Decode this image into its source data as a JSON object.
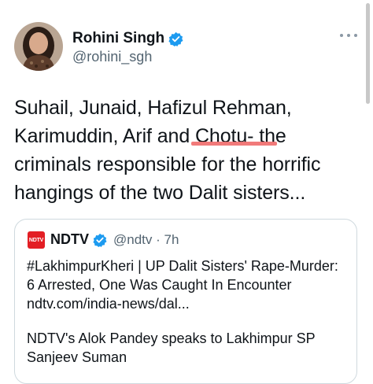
{
  "tweet": {
    "author": {
      "name": "Rohini Singh",
      "handle": "@rohini_sgh"
    },
    "lines": [
      "Suhail, Junaid, Hafizul Rehman,",
      "Karimuddin, Arif and Chotu- the",
      "criminals responsible for the horrific",
      "hangings of the two Dalit sisters..."
    ]
  },
  "quote": {
    "logo_text": "NDTV",
    "name": "NDTV",
    "handle_time": "@ndtv · 7h",
    "lines": [
      "#LakhimpurKheri | UP Dalit Sisters' Rape-Murder:",
      "6 Arrested, One Was Caught In Encounter",
      "ndtv.com/india-news/dal..."
    ],
    "para2": [
      "NDTV's Alok Pandey speaks to Lakhimpur SP",
      "Sanjeev Suman"
    ]
  },
  "colors": {
    "verified": "#1d9bf0",
    "annotation": "#ef6b6b",
    "ndtv_red": "#e31e24"
  },
  "icons": [
    "avatar",
    "verified-badge-icon",
    "more-options-icon",
    "ndtv-logo"
  ]
}
